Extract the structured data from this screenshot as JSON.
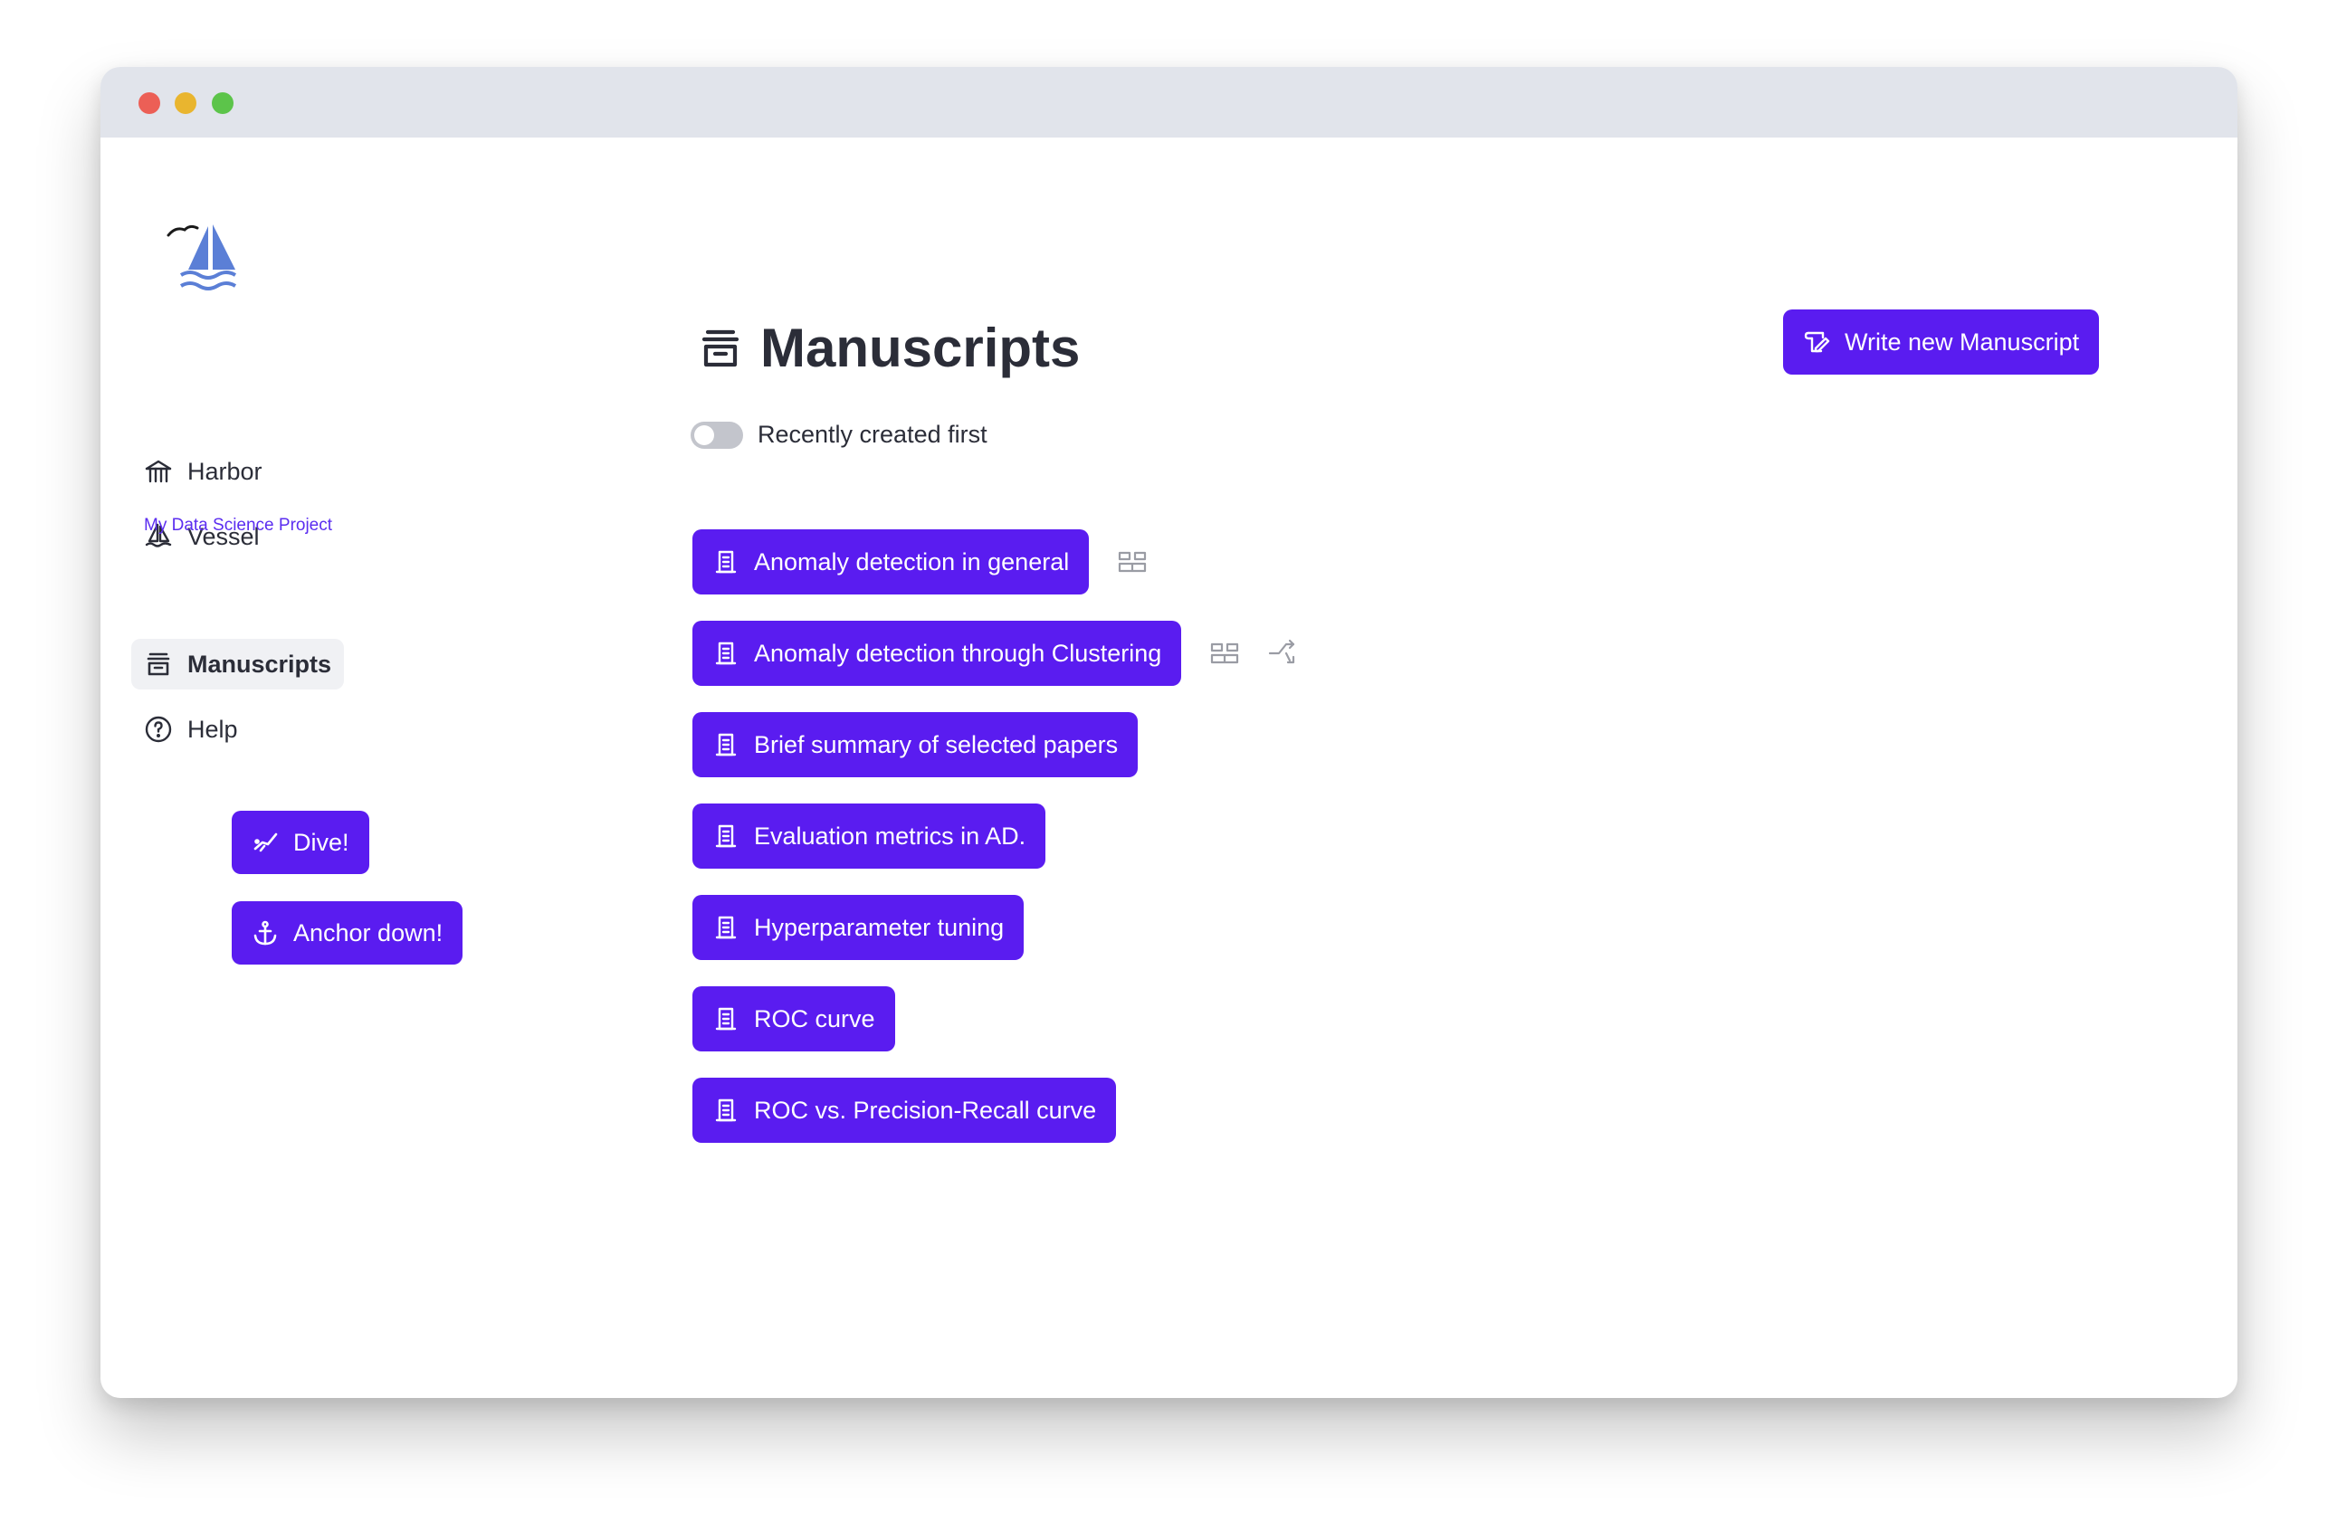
{
  "window": {
    "controls": [
      "close",
      "minimize",
      "maximize"
    ]
  },
  "sidebar": {
    "logo_icon": "sailboat-logo",
    "items": [
      {
        "label": "Harbor",
        "icon": "harbor-icon"
      },
      {
        "label": "Vessel",
        "icon": "sailboat-icon"
      }
    ],
    "project_label": "My Data Science Project",
    "project_items": [
      {
        "label": "Manuscripts",
        "icon": "archive-icon",
        "active": true
      },
      {
        "label": "Help",
        "icon": "help-circle-icon"
      }
    ],
    "actions": [
      {
        "label": "Dive!",
        "icon": "diver-icon"
      },
      {
        "label": "Anchor down!",
        "icon": "anchor-icon"
      }
    ]
  },
  "main": {
    "title": "Manuscripts",
    "title_icon": "archive-icon",
    "toggle_label": "Recently created first",
    "toggle_on": false,
    "write_button": "Write new Manuscript",
    "manuscripts": [
      {
        "label": "Anomaly detection in general",
        "extra_icons": [
          "layout-icon"
        ]
      },
      {
        "label": "Anomaly detection through Clustering",
        "extra_icons": [
          "layout-icon",
          "shuffle-icon"
        ]
      },
      {
        "label": "Brief summary of selected papers",
        "extra_icons": []
      },
      {
        "label": "Evaluation metrics in AD.",
        "extra_icons": []
      },
      {
        "label": "Hyperparameter tuning",
        "extra_icons": []
      },
      {
        "label": "ROC curve",
        "extra_icons": []
      },
      {
        "label": "ROC vs. Precision-Recall curve",
        "extra_icons": []
      }
    ]
  },
  "colors": {
    "accent": "#5a1cf0",
    "text": "#2b2d38",
    "logo": "#5b7fd6",
    "muted_icon": "#9a9ca4"
  }
}
